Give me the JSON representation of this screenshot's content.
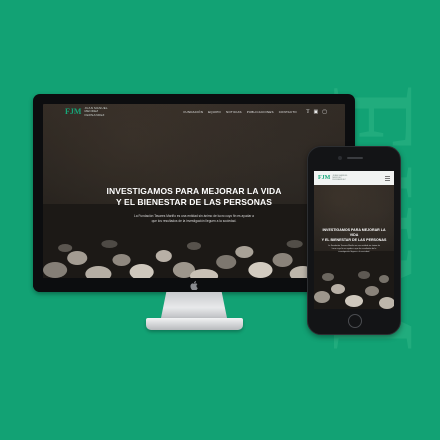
{
  "watermark": {
    "text": "FJIM"
  },
  "desktop": {
    "logo": "FJM",
    "brand": "JUAN MANUEL MENDEZ FERNANDEZ",
    "nav": [
      "FUNDACIÓN",
      "EQUIPO",
      "NOTICIAS",
      "PUBLICACIONES",
      "CONTACTO"
    ],
    "social": [
      "t",
      "f",
      "ig"
    ],
    "headline_line1": "INVESTIGAMOS PARA MEJORAR LA VIDA",
    "headline_line2": "Y EL BIENESTAR DE LAS PERSONAS",
    "subtitle": "La Fundación Tavares Mariño es una entidad sin ánimo de lucro cuyo fin es ayudar a que los resultados de la investigación lleguen a la sociedad."
  },
  "phone": {
    "logo": "FJM",
    "brand": "JUAN MANUEL MENDEZ FERNANDEZ",
    "headline_line1": "INVESTIGAMOS PARA MEJORAR LA VIDA",
    "headline_line2": "Y EL BIENESTAR DE LAS PERSONAS",
    "subtitle": "La Fundación Tavares Mariño es una entidad sin ánimo de lucro cuyo fin es ayudar a que los resultados de la investigación lleguen a la sociedad."
  },
  "colors": {
    "background": "#12a274",
    "brand": "#16a87a",
    "device": "#0c0d0f"
  }
}
